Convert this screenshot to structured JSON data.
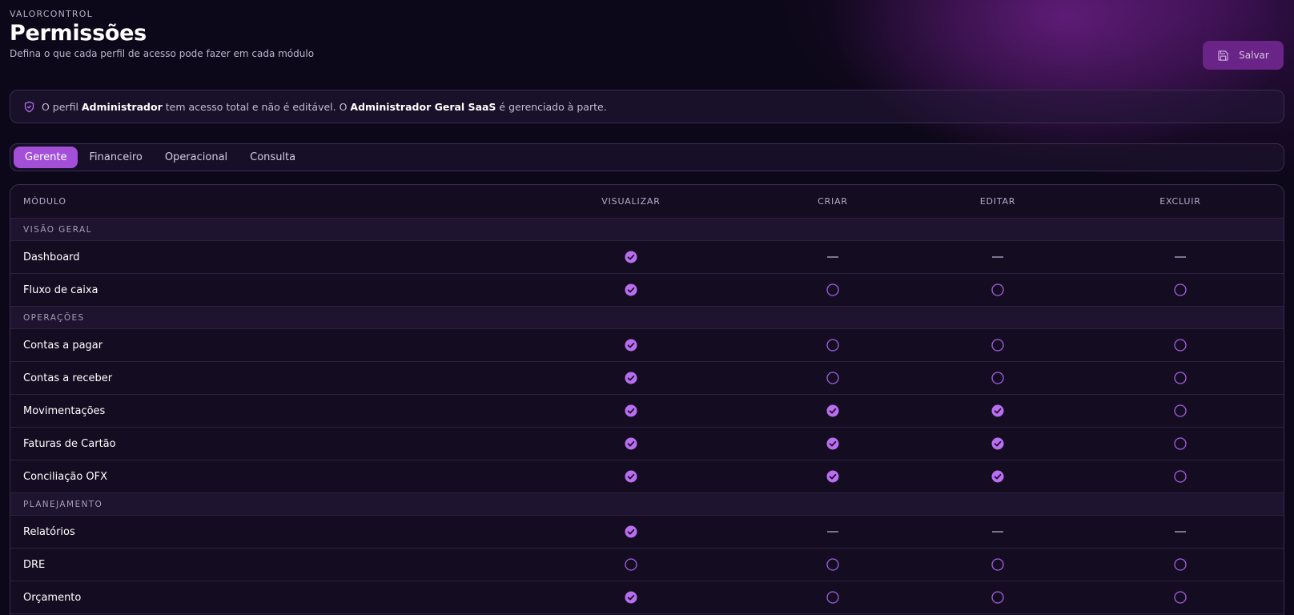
{
  "header": {
    "app_name": "VALORCONTROL",
    "title": "Permissões",
    "subtitle": "Defina o que cada perfil de acesso pode fazer em cada módulo",
    "save_label": "Salvar"
  },
  "notice": {
    "part1": "O perfil ",
    "bold1": "Administrador",
    "part2": " tem acesso total e não é editável. O ",
    "bold2": "Administrador Geral SaaS",
    "part3": " é gerenciado à parte."
  },
  "tabs": [
    {
      "label": "Gerente",
      "active": true
    },
    {
      "label": "Financeiro",
      "active": false
    },
    {
      "label": "Operacional",
      "active": false
    },
    {
      "label": "Consulta",
      "active": false
    }
  ],
  "table": {
    "columns": [
      "MÓDULO",
      "VISUALIZAR",
      "CRIAR",
      "EDITAR",
      "EXCLUIR"
    ],
    "sections": [
      {
        "label": "VISÃO GERAL",
        "rows": [
          {
            "module": "Dashboard",
            "perms": [
              "on",
              "na",
              "na",
              "na"
            ]
          },
          {
            "module": "Fluxo de caixa",
            "perms": [
              "on",
              "off",
              "off",
              "off"
            ]
          }
        ]
      },
      {
        "label": "OPERAÇÕES",
        "rows": [
          {
            "module": "Contas a pagar",
            "perms": [
              "on",
              "off",
              "off",
              "off"
            ]
          },
          {
            "module": "Contas a receber",
            "perms": [
              "on",
              "off",
              "off",
              "off"
            ]
          },
          {
            "module": "Movimentações",
            "perms": [
              "on",
              "on",
              "on",
              "off"
            ]
          },
          {
            "module": "Faturas de Cartão",
            "perms": [
              "on",
              "on",
              "on",
              "off"
            ]
          },
          {
            "module": "Conciliação OFX",
            "perms": [
              "on",
              "on",
              "on",
              "off"
            ]
          }
        ]
      },
      {
        "label": "PLANEJAMENTO",
        "rows": [
          {
            "module": "Relatórios",
            "perms": [
              "on",
              "na",
              "na",
              "na"
            ]
          },
          {
            "module": "DRE",
            "perms": [
              "off",
              "off",
              "off",
              "off"
            ]
          },
          {
            "module": "Orçamento",
            "perms": [
              "on",
              "off",
              "off",
              "off"
            ]
          }
        ]
      }
    ]
  },
  "colors": {
    "accent": "#a34fd8",
    "check_fill": "#b96ef0",
    "circle_stroke": "#a45fe0",
    "save_bg": "#6a2386",
    "background": "#0d0819"
  },
  "icons": {
    "save": "save-icon",
    "notice": "shield-check-icon",
    "checked": "check-circle-icon",
    "unchecked": "circle-icon",
    "not_applicable": "dash-icon"
  }
}
